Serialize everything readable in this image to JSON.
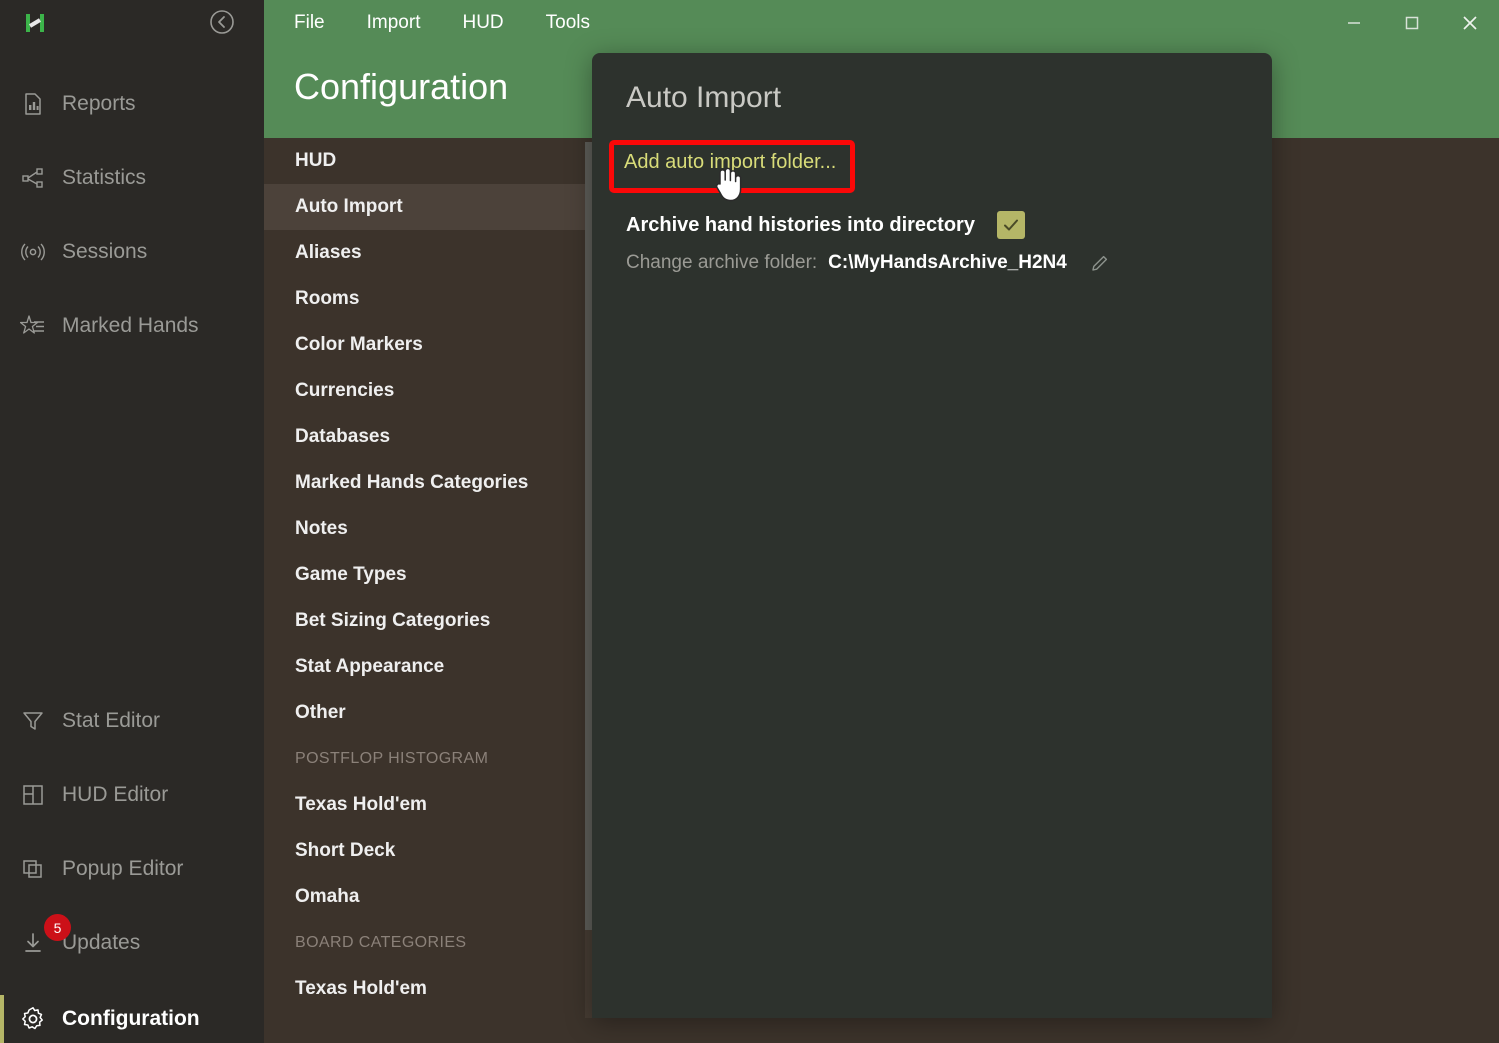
{
  "app": {
    "logo_icon": "hand2note-h-logo",
    "accent_green": "#558b57",
    "accent_olive": "#b5b667",
    "highlight_red": "#fb0808",
    "panel_bg": "#2d322d",
    "brown_bg": "#3c332b",
    "sidebar_bg": "#2b2926"
  },
  "sidebar": {
    "collapse_icon": "chevron-left-circle-icon",
    "items": [
      {
        "label": "Reports",
        "icon": "report-chart-icon",
        "active": false
      },
      {
        "label": "Statistics",
        "icon": "statistics-share-icon",
        "active": false
      },
      {
        "label": "Sessions",
        "icon": "sessions-signal-icon",
        "active": false
      },
      {
        "label": "Marked Hands",
        "icon": "star-list-icon",
        "active": false
      },
      {
        "label": "Stat Editor",
        "icon": "funnel-icon",
        "active": false
      },
      {
        "label": "HUD Editor",
        "icon": "layout-grid-icon",
        "active": false
      },
      {
        "label": "Popup Editor",
        "icon": "windows-stack-icon",
        "active": false
      },
      {
        "label": "Updates",
        "icon": "download-icon",
        "active": false,
        "badge": "5"
      },
      {
        "label": "Configuration",
        "icon": "gear-icon",
        "active": true
      }
    ]
  },
  "menubar": {
    "items": [
      "File",
      "Import",
      "HUD",
      "Tools"
    ]
  },
  "window_controls": {
    "minimize": "minimize-icon",
    "maximize": "maximize-icon",
    "close": "close-icon"
  },
  "header": {
    "title": "Configuration"
  },
  "config_list": {
    "items": [
      {
        "label": "HUD",
        "type": "item",
        "selected": false
      },
      {
        "label": "Auto Import",
        "type": "item",
        "selected": true
      },
      {
        "label": "Aliases",
        "type": "item",
        "selected": false
      },
      {
        "label": "Rooms",
        "type": "item",
        "selected": false
      },
      {
        "label": "Color Markers",
        "type": "item",
        "selected": false
      },
      {
        "label": "Currencies",
        "type": "item",
        "selected": false
      },
      {
        "label": "Databases",
        "type": "item",
        "selected": false
      },
      {
        "label": "Marked Hands Categories",
        "type": "item",
        "selected": false
      },
      {
        "label": "Notes",
        "type": "item",
        "selected": false
      },
      {
        "label": "Game Types",
        "type": "item",
        "selected": false
      },
      {
        "label": "Bet Sizing Categories",
        "type": "item",
        "selected": false
      },
      {
        "label": "Stat Appearance",
        "type": "item",
        "selected": false
      },
      {
        "label": "Other",
        "type": "item",
        "selected": false
      },
      {
        "label": "POSTFLOP HISTOGRAM",
        "type": "section",
        "selected": false
      },
      {
        "label": "Texas Hold'em",
        "type": "item",
        "selected": false
      },
      {
        "label": "Short Deck",
        "type": "item",
        "selected": false
      },
      {
        "label": "Omaha",
        "type": "item",
        "selected": false
      },
      {
        "label": "BOARD CATEGORIES",
        "type": "section",
        "selected": false
      },
      {
        "label": "Texas Hold'em",
        "type": "item",
        "selected": false
      }
    ]
  },
  "detail_panel": {
    "title": "Auto Import",
    "add_folder_label": "Add auto import folder...",
    "archive_label": "Archive hand histories into directory",
    "archive_checked": true,
    "archive_check_icon": "checkmark-icon",
    "change_folder_label": "Change archive folder:",
    "change_folder_value": "C:\\MyHandsArchive_H2N4",
    "edit_icon": "pencil-icon"
  },
  "cursor": {
    "icon": "pointing-hand-cursor"
  }
}
